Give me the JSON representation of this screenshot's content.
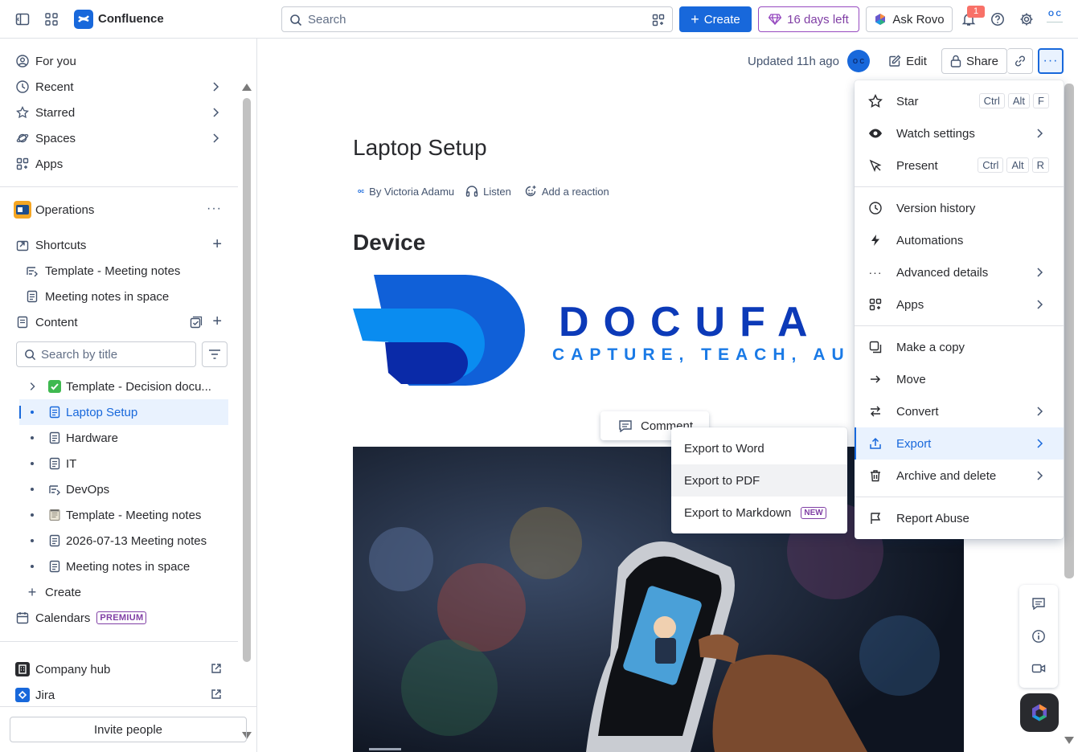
{
  "app": {
    "name": "Confluence"
  },
  "topbar": {
    "search_placeholder": "Search",
    "create_label": "Create",
    "trial_label": "16 days left",
    "rovo_label": "Ask Rovo",
    "notification_count": "1",
    "avatar_initials": "O C"
  },
  "sidebar": {
    "nav": [
      {
        "label": "For you"
      },
      {
        "label": "Recent"
      },
      {
        "label": "Starred"
      },
      {
        "label": "Spaces"
      },
      {
        "label": "Apps"
      }
    ],
    "space_name": "Operations",
    "shortcuts_label": "Shortcuts",
    "shortcuts": [
      {
        "label": "Template - Meeting notes"
      },
      {
        "label": "Meeting notes in space"
      }
    ],
    "content_label": "Content",
    "search_placeholder": "Search by title",
    "tree": [
      {
        "label": "Template - Decision docu..."
      },
      {
        "label": "Laptop Setup"
      },
      {
        "label": "Hardware"
      },
      {
        "label": "IT"
      },
      {
        "label": "DevOps"
      },
      {
        "label": "Template - Meeting notes"
      },
      {
        "label": "2026-07-13 Meeting notes"
      },
      {
        "label": "Meeting notes in space"
      }
    ],
    "create_label": "Create",
    "calendars_label": "Calendars",
    "premium_badge": "PREMIUM",
    "company_hub_label": "Company hub",
    "jira_label": "Jira",
    "invite_label": "Invite people"
  },
  "page": {
    "updated": "Updated 11h ago",
    "avatar_initials": "O C",
    "edit_label": "Edit",
    "share_label": "Share",
    "title": "Laptop Setup",
    "author": "By Victoria Adamu",
    "listen_label": "Listen",
    "reaction_label": "Add a reaction",
    "heading": "Device",
    "logo_text": "DOCUFA",
    "logo_subtext": "CAPTURE, TEACH, AU",
    "comment_label": "Comment"
  },
  "more_menu": {
    "items": [
      {
        "label": "Star",
        "keys": [
          "Ctrl",
          "Alt",
          "F"
        ]
      },
      {
        "label": "Watch settings"
      },
      {
        "label": "Present",
        "keys": [
          "Ctrl",
          "Alt",
          "R"
        ]
      },
      {
        "label": "Version history"
      },
      {
        "label": "Automations"
      },
      {
        "label": "Advanced details"
      },
      {
        "label": "Apps"
      },
      {
        "label": "Make a copy"
      },
      {
        "label": "Move"
      },
      {
        "label": "Convert"
      },
      {
        "label": "Export"
      },
      {
        "label": "Archive and delete"
      },
      {
        "label": "Report Abuse"
      }
    ]
  },
  "export_menu": {
    "items": [
      {
        "label": "Export to Word"
      },
      {
        "label": "Export to PDF"
      },
      {
        "label": "Export to Markdown"
      }
    ],
    "new_badge": "NEW"
  },
  "colors": {
    "accent": "#1868db",
    "premium": "#803fa5"
  }
}
